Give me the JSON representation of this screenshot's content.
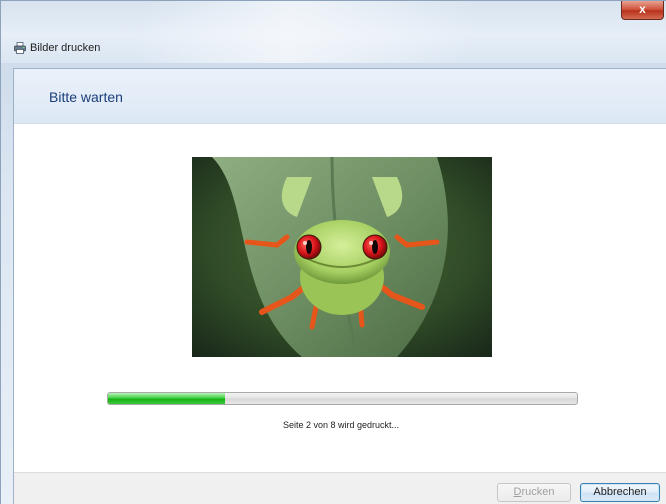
{
  "window": {
    "title": "Bilder drucken",
    "close_label": "x"
  },
  "header": {
    "title": "Bitte warten"
  },
  "preview": {
    "image": "tree-frog-photo"
  },
  "progress": {
    "fraction": 0.25,
    "status": "Seite 2 von 8 wird gedruckt..."
  },
  "buttons": {
    "print_label": "Drucken",
    "print_mnemonic": "D",
    "print_rest": "rucken",
    "cancel_label": "Abbrechen"
  },
  "colors": {
    "progress_fill": "#16b216",
    "header_text": "#1a3e7a"
  }
}
